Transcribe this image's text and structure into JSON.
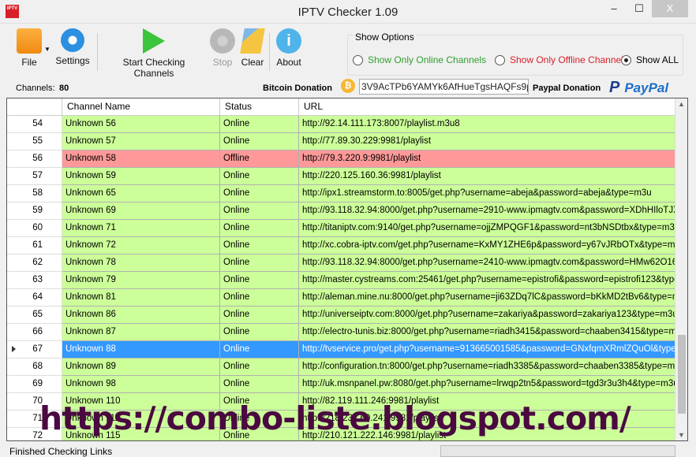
{
  "window": {
    "title": "IPTV Checker 1.09",
    "icon_text": "IPTV Checker",
    "minimize": "–",
    "maximize": "☐",
    "close": "X"
  },
  "toolbar": {
    "file": "File",
    "settings": "Settings",
    "start": "Start Checking Channels",
    "stop": "Stop",
    "clear": "Clear",
    "about": "About"
  },
  "options": {
    "legend": "Show Options",
    "online": "Show Only Online Channels",
    "offline": "Show Only Offline Channels",
    "all": "Show ALL",
    "selected": "all",
    "online_color": "#2e9e2e",
    "offline_color": "#d9202a"
  },
  "info": {
    "channels_label": "Channels:",
    "channels_count": "80",
    "bitcoin_label": "Bitcoin Donation",
    "bitcoin_address": "3V9AcTPb6YAMYk6AfHueTgsHAQFs9ptvF",
    "paypal_label": "Paypal Donation",
    "paypal_logo": "PayPal"
  },
  "grid": {
    "columns": [
      "Channel Name",
      "Status",
      "URL"
    ],
    "rows": [
      {
        "n": "54",
        "name": "Unknown 56",
        "status": "Online",
        "url": "http://92.14.111.173:8007/playlist.m3u8"
      },
      {
        "n": "55",
        "name": "Unknown 57",
        "status": "Online",
        "url": "http://77.89.30.229:9981/playlist"
      },
      {
        "n": "56",
        "name": "Unknown 58",
        "status": "Offline",
        "url": "http://79.3.220.9:9981/playlist"
      },
      {
        "n": "57",
        "name": "Unknown 59",
        "status": "Online",
        "url": "http://220.125.160.36:9981/playlist"
      },
      {
        "n": "58",
        "name": "Unknown 65",
        "status": "Online",
        "url": "http://ipx1.streamstorm.to:8005/get.php?username=abeja&password=abeja&type=m3u"
      },
      {
        "n": "59",
        "name": "Unknown 69",
        "status": "Online",
        "url": "http://93.118.32.94:8000/get.php?username=2910-www.ipmagtv.com&password=XDhHIloTJX&..."
      },
      {
        "n": "60",
        "name": "Unknown 71",
        "status": "Online",
        "url": "http://titaniptv.com:9140/get.php?username=ojjZMPQGF1&password=nt3bNSDtbx&type=m3u"
      },
      {
        "n": "61",
        "name": "Unknown 72",
        "status": "Online",
        "url": "http://xc.cobra-iptv.com/get.php?username=KxMY1ZHE6p&password=y67vJRbOTx&type=m3u"
      },
      {
        "n": "62",
        "name": "Unknown 78",
        "status": "Online",
        "url": "http://93.118.32.94:8000/get.php?username=2410-www.ipmagtv.com&password=HMw62O16h..."
      },
      {
        "n": "63",
        "name": "Unknown 79",
        "status": "Online",
        "url": "http://master.cystreams.com:25461/get.php?username=epistrofi&password=epistrofi123&type=m3u"
      },
      {
        "n": "64",
        "name": "Unknown 81",
        "status": "Online",
        "url": "http://aleman.mine.nu:8000/get.php?username=ji63ZDq7lC&password=bKkMD2tBv6&type=m3u"
      },
      {
        "n": "65",
        "name": "Unknown 86",
        "status": "Online",
        "url": "http://universeiptv.com:8000/get.php?username=zakariya&password=zakariya123&type=m3u_plus"
      },
      {
        "n": "66",
        "name": "Unknown 87",
        "status": "Online",
        "url": "http://electro-tunis.biz:8000/get.php?username=riadh3415&password=chaaben3415&type=m3u_..."
      },
      {
        "n": "67",
        "name": "Unknown 88",
        "status": "Online",
        "url": "http://tvservice.pro/get.php?username=913665001585&password=GNxfqmXRmlZQuOl&type=m3u",
        "selected": true
      },
      {
        "n": "68",
        "name": "Unknown 89",
        "status": "Online",
        "url": "http://configuration.tn:8000/get.php?username=riadh3385&password=chaaben3385&type=m3u"
      },
      {
        "n": "69",
        "name": "Unknown 98",
        "status": "Online",
        "url": "http://uk.msnpanel.pw:8080/get.php?username=lrwqp2tn5&password=tgd3r3u3h4&type=m3u"
      },
      {
        "n": "70",
        "name": "Unknown 110",
        "status": "Online",
        "url": "http://82.119.111.246:9981/playlist"
      },
      {
        "n": "71",
        "name": "Unknown 111",
        "status": "Online",
        "url": "http://218.237.60.241:9981/playlist"
      },
      {
        "n": "72",
        "name": "Unknown 115",
        "status": "Online",
        "url": "http://210.121.222.146:9981/playlist"
      }
    ]
  },
  "status": {
    "text": "Finished Checking Links"
  },
  "watermark": "https://combo-liste.blogspot.com/"
}
